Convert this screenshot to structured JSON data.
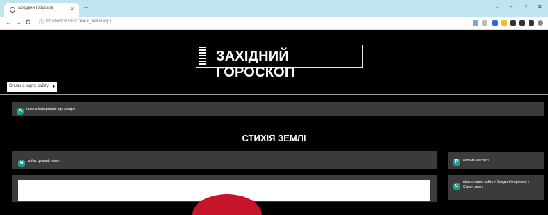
{
  "browser": {
    "tab_title": "західний гороскоп",
    "tab_close": "×",
    "new_tab": "+",
    "url": "localhost:50963/Стихія_землі.aspx",
    "nav": {
      "back": "←",
      "forward": "→",
      "reload": "C"
    },
    "window_controls": {
      "minimize": "–",
      "restore": "□",
      "close": "✕",
      "dropdown": "⌄"
    },
    "extension_colors": [
      "#7aa7d6",
      "#f0c020",
      "#2a6ad8",
      "#333333",
      "#333333",
      "#333333",
      "#333333",
      "#888888"
    ]
  },
  "site": {
    "title": "ЗАХІДНИЙ ГОРОСКОП",
    "sitemap_button": "Опільна карта сайту",
    "sitemap_arrow": "▸"
  },
  "bars": {
    "general": {
      "badge": "А",
      "text": "гальна інформація про розділ"
    },
    "section_title": "СТИХІЯ ЗЕМЛІ",
    "content": {
      "badge": "Я",
      "text": "кийсь цікавий текст."
    },
    "ads": {
      "badge": "Р",
      "text": "еклама на сайті"
    },
    "sitemap_path": {
      "badge": "С",
      "text": "пільна карта сайту > Західний гороскоп > Стихія землі"
    }
  }
}
